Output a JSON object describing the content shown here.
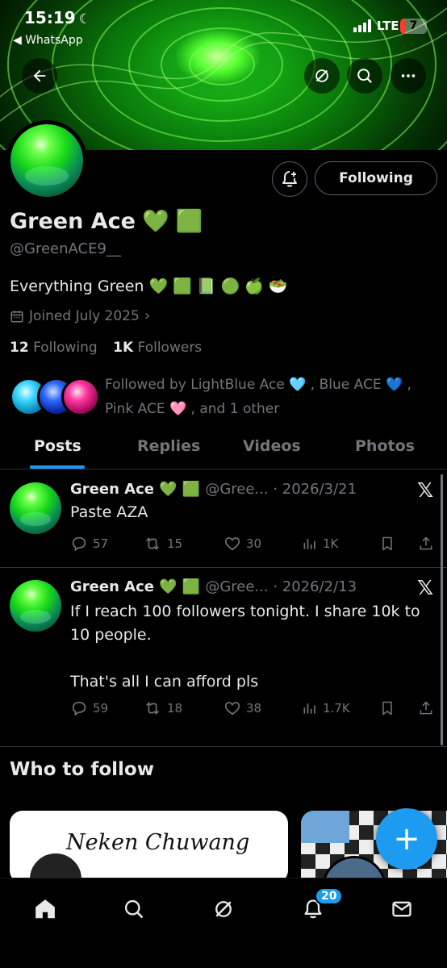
{
  "status_bar": {
    "time": "15:19",
    "back_app": "◀ WhatsApp",
    "network": "LTE",
    "battery": "7"
  },
  "profile": {
    "name": "Green Ace",
    "name_emojis": [
      "💚",
      "🟩"
    ],
    "handle": "@GreenACE9__",
    "bio": "Everything Green",
    "bio_emojis": [
      "💚",
      "🟩",
      "📗",
      "🟢",
      "🍏",
      "🥗"
    ],
    "joined": "Joined July 2025",
    "following_count": "12",
    "following_label": "Following",
    "followers_count": "1K",
    "followers_label": "Followers",
    "followed_by": "Followed by LightBlue Ace 🩵 , Blue ACE 💙 , Pink ACE 🩷 , and 1 other",
    "follow_button": "Following"
  },
  "tabs": [
    {
      "label": "Posts",
      "active": true
    },
    {
      "label": "Replies",
      "active": false
    },
    {
      "label": "Videos",
      "active": false
    },
    {
      "label": "Photos",
      "active": false
    }
  ],
  "posts": [
    {
      "name": "Green Ace 💚 🟩",
      "meta": "@Gree... · 2026/3/21",
      "text": "Paste AZA",
      "replies": "57",
      "reposts": "15",
      "likes": "30",
      "views": "1K"
    },
    {
      "name": "Green Ace 💚 🟩",
      "meta": "@Gree... · 2026/2/13",
      "text": "If I reach 100 followers tonight. I share 10k to 10 people.\n\nThat's all I can afford pls",
      "replies": "59",
      "reposts": "18",
      "likes": "38",
      "views": "1.7K"
    }
  ],
  "who_to_follow": {
    "title": "Who to follow",
    "card1_banner_text": "Neken Chuwang"
  },
  "fab": "+",
  "nav": {
    "notifications_badge": "20"
  },
  "colors": {
    "accent": "#1d9bf0",
    "bg": "#000000",
    "muted": "#71767b",
    "text": "#e7e9ea"
  }
}
